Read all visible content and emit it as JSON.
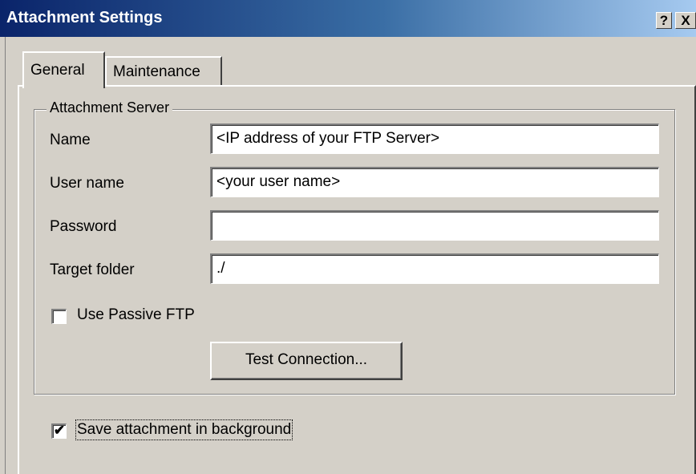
{
  "window": {
    "title": "Attachment Settings",
    "help_glyph": "?",
    "close_glyph": "X"
  },
  "tabs": [
    {
      "label": "General",
      "selected": true
    },
    {
      "label": "Maintenance",
      "selected": false
    }
  ],
  "server_group": {
    "legend": "Attachment Server",
    "fields": {
      "name": {
        "label": "Name",
        "value": "<IP address of your FTP Server>"
      },
      "user_name": {
        "label": "User name",
        "value": "<your user name>"
      },
      "password": {
        "label": "Password",
        "value": ""
      },
      "target_folder": {
        "label": "Target folder",
        "value": "./"
      }
    },
    "passive_ftp": {
      "label": "Use Passive FTP",
      "checked": false,
      "mark": ""
    },
    "test_button": {
      "label": "Test Connection..."
    }
  },
  "save_background": {
    "label": "Save attachment in background",
    "checked": true,
    "mark": "✔"
  }
}
